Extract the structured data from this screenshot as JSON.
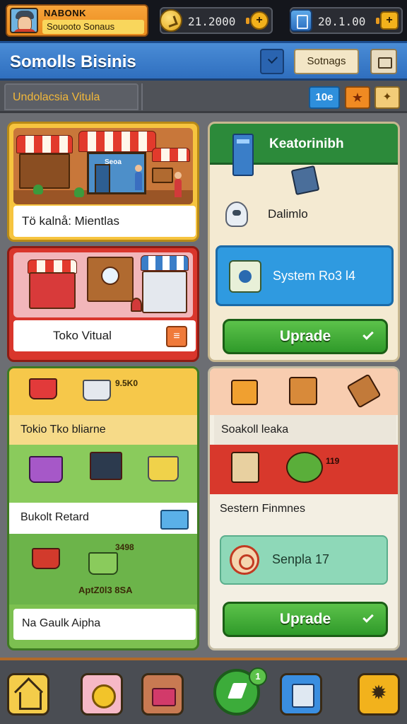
{
  "topbar": {
    "player_name": "NABONK",
    "player_subtitle": "Souooto Sonaus",
    "coins": "21.2000",
    "gems": "20.1.00"
  },
  "header": {
    "title": "Somolls Bisinis",
    "settings_label": "Sotnags"
  },
  "subbar": {
    "tab_label": "Undolacsia Vitula",
    "badge": "10e"
  },
  "cards": {
    "shop": {
      "sign": "Seoa",
      "caption": "Tö kalnå: Mientlas"
    },
    "virtual": {
      "caption": "Toko Vitual"
    },
    "system": {
      "title": "Keatorinibh",
      "robot_label": "Dalimlo",
      "package_label": "System Ro3 l4",
      "upgrade_label": "Uprade"
    },
    "retail": {
      "top_value": "9.5K0",
      "row1": "Tokio Tko bliarne",
      "row2": "Bukolt Retard",
      "bottom_value": "3498",
      "bottom_caption": "AptZ0l3 8SA",
      "row3": "Na Gaulk Aipha"
    },
    "season": {
      "row1": "Soakoll leaka",
      "value": "119",
      "row2": "Sestern Finmnes",
      "sample_label": "Senpla 17",
      "upgrade_label": "Uprade"
    }
  },
  "navbar": {
    "play_badge": "1"
  },
  "colors": {
    "header_blue": "#2f6fbf",
    "upgrade_green": "#2f9a2a",
    "accent_orange": "#f08a22"
  },
  "icons": [
    "avatar",
    "coin-icon",
    "gem-icon",
    "check-icon",
    "mail-icon",
    "star-icon",
    "puzzle-icon",
    "server-icon",
    "tablet-icon",
    "robot-icon",
    "package-icon",
    "basket-icon",
    "cart-icon",
    "laptop-icon",
    "fruit-icon",
    "medal-icon",
    "home-icon",
    "coins-icon",
    "shop-icon",
    "play-icon",
    "map-icon",
    "gear-icon"
  ]
}
